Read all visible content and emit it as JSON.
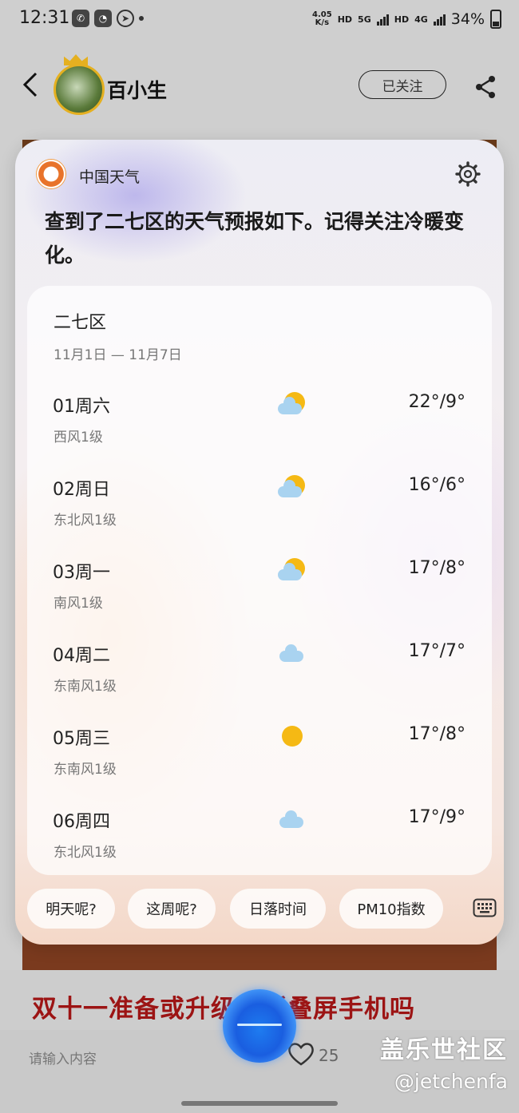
{
  "status_bar": {
    "time": "12:31",
    "net_speed_value": "4.05",
    "net_speed_unit": "K/s",
    "hd1": "HD",
    "five_g": "5G",
    "hd2": "HD",
    "four_g": "4G",
    "battery": "34%"
  },
  "header": {
    "username": "百小生",
    "follow_label": "已关注"
  },
  "assistant": {
    "source_name": "中国天气",
    "answer": "查到了二七区的天气预报如下。记得关注冷暖变化。",
    "location": "二七区",
    "date_range": "11月1日 — 11月7日",
    "days": [
      {
        "label": "01周六",
        "wind": "西风1级",
        "temp": "22°/9°",
        "icon": "partly-cloudy-icon"
      },
      {
        "label": "02周日",
        "wind": "东北风1级",
        "temp": "16°/6°",
        "icon": "partly-cloudy-icon"
      },
      {
        "label": "03周一",
        "wind": "南风1级",
        "temp": "17°/8°",
        "icon": "partly-cloudy-icon"
      },
      {
        "label": "04周二",
        "wind": "东南风1级",
        "temp": "17°/7°",
        "icon": "cloud-icon"
      },
      {
        "label": "05周三",
        "wind": "东南风1级",
        "temp": "17°/8°",
        "icon": "sun-icon"
      },
      {
        "label": "06周四",
        "wind": "东北风1级",
        "temp": "17°/9°",
        "icon": "cloud-icon"
      }
    ],
    "chips": [
      "明天呢?",
      "这周呢?",
      "日落时间",
      "PM10指数"
    ]
  },
  "article": {
    "headline": "双十一准备或升级了折叠屏手机吗"
  },
  "bottom": {
    "comment_placeholder": "请输入内容",
    "like_count": "25"
  },
  "watermark": {
    "line1": "盖乐世社区",
    "line2": "@jetchenfa"
  },
  "colors": {
    "sun": "#f5b914",
    "cloud": "#a9d3f0",
    "follow_border": "#222222",
    "headline": "#9c1414",
    "bixby": "#1a5ee0"
  }
}
